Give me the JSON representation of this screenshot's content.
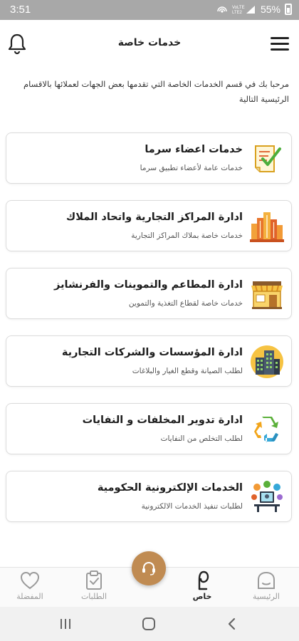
{
  "status_bar": {
    "time": "3:51",
    "battery": "55%"
  },
  "header": {
    "title": "خدمات خاصة"
  },
  "intro": {
    "text": "مرحبا بك في قسم الخدمات الخاصة التي تقدمها بعض الجهات لعملائها بالاقسام الرئيسية التالية"
  },
  "services": [
    {
      "title": "خدمات اعضاء سرما",
      "subtitle": "خدمات عامة لأعضاء تطبيق سرما",
      "icon": "checklist-document-icon"
    },
    {
      "title": "ادارة المراكز التجارية واتحاد الملاك",
      "subtitle": "خدمات خاصة بملاك المراكز التجارية",
      "icon": "buildings-icon"
    },
    {
      "title": "ادارة المطاعم والتموينات والفرنشايز",
      "subtitle": "خدمات خاصة لقطاع التغذية والتموين",
      "icon": "storefront-icon"
    },
    {
      "title": "ادارة المؤسسات والشركات التجارية",
      "subtitle": "لطلب الصيانة وقطع الغيار والبلاغات",
      "icon": "office-towers-icon"
    },
    {
      "title": "ادارة تدوير المخلفات و النفايات",
      "subtitle": "لطلب التخلص من النفايات",
      "icon": "recycle-icon"
    },
    {
      "title": "الخدمات الإلكترونية الحكومية",
      "subtitle": "لطلبات تنفيذ الخدمات الالكترونية",
      "icon": "e-government-icon"
    }
  ],
  "bottom_nav": {
    "home": "الرئيسية",
    "private": "خاص",
    "requests": "الطلبات",
    "favorites": "المفضلة"
  },
  "colors": {
    "accent": "#c08b52",
    "status_bar": "#a8a8a8",
    "inactive": "#9a9a9a"
  }
}
